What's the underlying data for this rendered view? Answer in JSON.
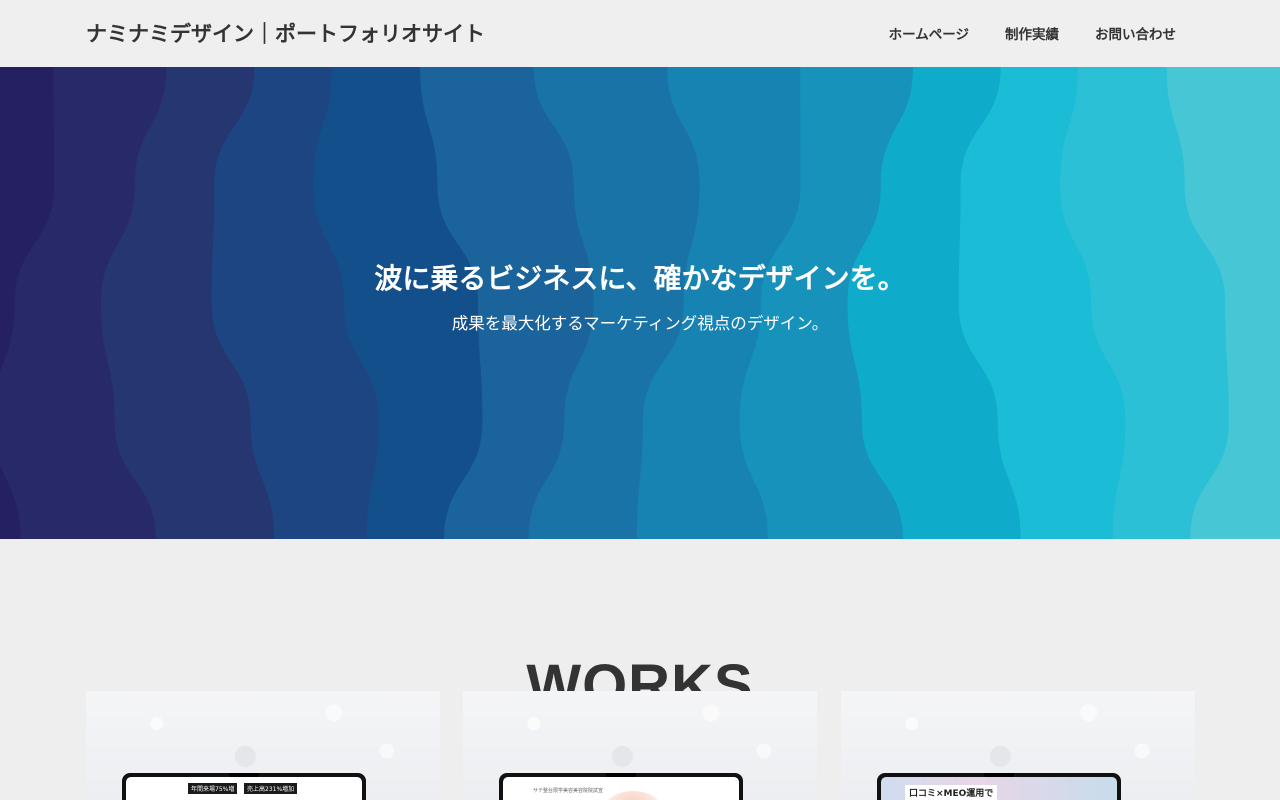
{
  "header": {
    "site_title": "ナミナミデザイン｜ポートフォリオサイト",
    "nav": [
      {
        "label": "ホームページ"
      },
      {
        "label": "制作実績"
      },
      {
        "label": "お問い合わせ"
      }
    ]
  },
  "hero": {
    "title": "波に乗るビジネスに、確かなデザインを。",
    "subtitle": "成果を最大化するマーケティング視点のデザイン。",
    "wave_colors": [
      "#25205f",
      "#282a68",
      "#253670",
      "#1d4582",
      "#124f8b",
      "#1b649b",
      "#1a73a6",
      "#1683b3",
      "#1692bb",
      "#0fabca",
      "#1bbcd6",
      "#2cc0d7",
      "#47c6d6"
    ]
  },
  "works": {
    "heading": "WORKS",
    "cards": [
      {
        "screen_tags": [
          "年間来場75%増",
          "売上高231%増加"
        ]
      },
      {
        "screen_caption": "サテ整台限学美容美容院院試宣"
      },
      {
        "screen_headline": "口コミ×MEO運用で"
      }
    ]
  }
}
